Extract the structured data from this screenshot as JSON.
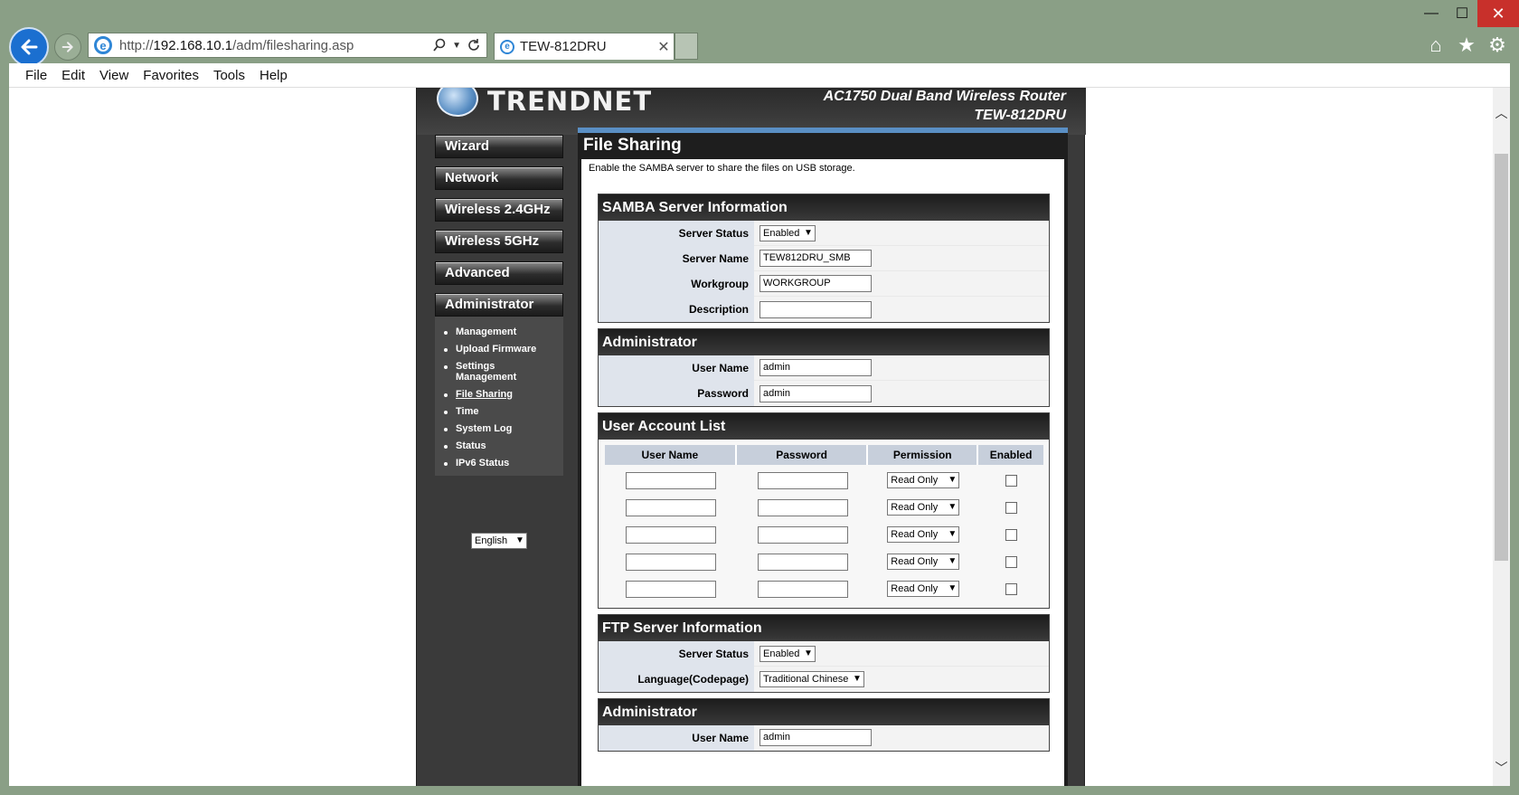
{
  "browser": {
    "window_controls": {
      "minimize": "—",
      "maximize": "☐",
      "close": "✕"
    },
    "url_prefix": "http://",
    "url_host": "192.168.10.1",
    "url_path": "/adm/filesharing.asp",
    "tab_title": "TEW-812DRU",
    "menu": [
      "File",
      "Edit",
      "View",
      "Favorites",
      "Tools",
      "Help"
    ]
  },
  "router": {
    "logo": "TRENDNET",
    "model_line1": "AC1750 Dual Band Wireless Router",
    "model_line2": "TEW-812DRU",
    "nav": [
      "Wizard",
      "Network",
      "Wireless 2.4GHz",
      "Wireless 5GHz",
      "Advanced",
      "Administrator"
    ],
    "admin_submenu": [
      "Management",
      "Upload Firmware",
      "Settings Management",
      "File Sharing",
      "Time",
      "System Log",
      "Status",
      "IPv6 Status"
    ],
    "active_submenu": "File Sharing",
    "language": "English"
  },
  "page": {
    "title": "File Sharing",
    "intro": "Enable the SAMBA server to share the files on USB storage.",
    "samba": {
      "title": "SAMBA Server Information",
      "server_status_label": "Server Status",
      "server_status": "Enabled",
      "server_name_label": "Server Name",
      "server_name": "TEW812DRU_SMB",
      "workgroup_label": "Workgroup",
      "workgroup": "WORKGROUP",
      "description_label": "Description",
      "description": ""
    },
    "admin": {
      "title": "Administrator",
      "user_label": "User Name",
      "user": "admin",
      "password_label": "Password",
      "password": "admin"
    },
    "accounts": {
      "title": "User Account List",
      "headers": [
        "User Name",
        "Password",
        "Permission",
        "Enabled"
      ],
      "rows": [
        {
          "user": "",
          "password": "",
          "permission": "Read Only",
          "enabled": false
        },
        {
          "user": "",
          "password": "",
          "permission": "Read Only",
          "enabled": false
        },
        {
          "user": "",
          "password": "",
          "permission": "Read Only",
          "enabled": false
        },
        {
          "user": "",
          "password": "",
          "permission": "Read Only",
          "enabled": false
        },
        {
          "user": "",
          "password": "",
          "permission": "Read Only",
          "enabled": false
        }
      ]
    },
    "ftp": {
      "title": "FTP Server Information",
      "server_status_label": "Server Status",
      "server_status": "Enabled",
      "language_label": "Language(Codepage)",
      "language": "Traditional Chinese"
    },
    "ftp_admin": {
      "title": "Administrator",
      "user_label": "User Name",
      "user": "admin"
    }
  }
}
